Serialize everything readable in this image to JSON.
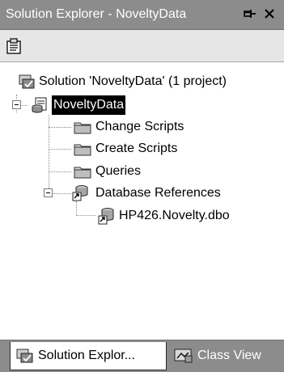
{
  "window": {
    "title": "Solution Explorer - NoveltyData",
    "pin_icon": "pushpin-icon",
    "close_icon": "close-icon"
  },
  "toolbar": {
    "properties_icon": "properties-icon"
  },
  "tree": {
    "solution": {
      "label": "Solution 'NoveltyData' (1 project)",
      "icon": "solution-icon"
    },
    "project": {
      "label": "NoveltyData",
      "icon": "database-project-icon",
      "selected": true,
      "expanded": true
    },
    "folders": [
      {
        "label": "Change Scripts",
        "icon": "folder-icon"
      },
      {
        "label": "Create Scripts",
        "icon": "folder-icon"
      },
      {
        "label": "Queries",
        "icon": "folder-icon"
      }
    ],
    "references": {
      "label": "Database References",
      "icon": "database-references-icon",
      "expanded": true
    },
    "reference_item": {
      "label": "HP426.Novelty.dbo",
      "icon": "database-reference-icon"
    }
  },
  "tabs": {
    "solution_explorer": {
      "label": "Solution Explor...",
      "icon": "solution-explorer-icon",
      "active": true
    },
    "class_view": {
      "label": "Class View",
      "icon": "class-view-icon",
      "active": false
    }
  }
}
